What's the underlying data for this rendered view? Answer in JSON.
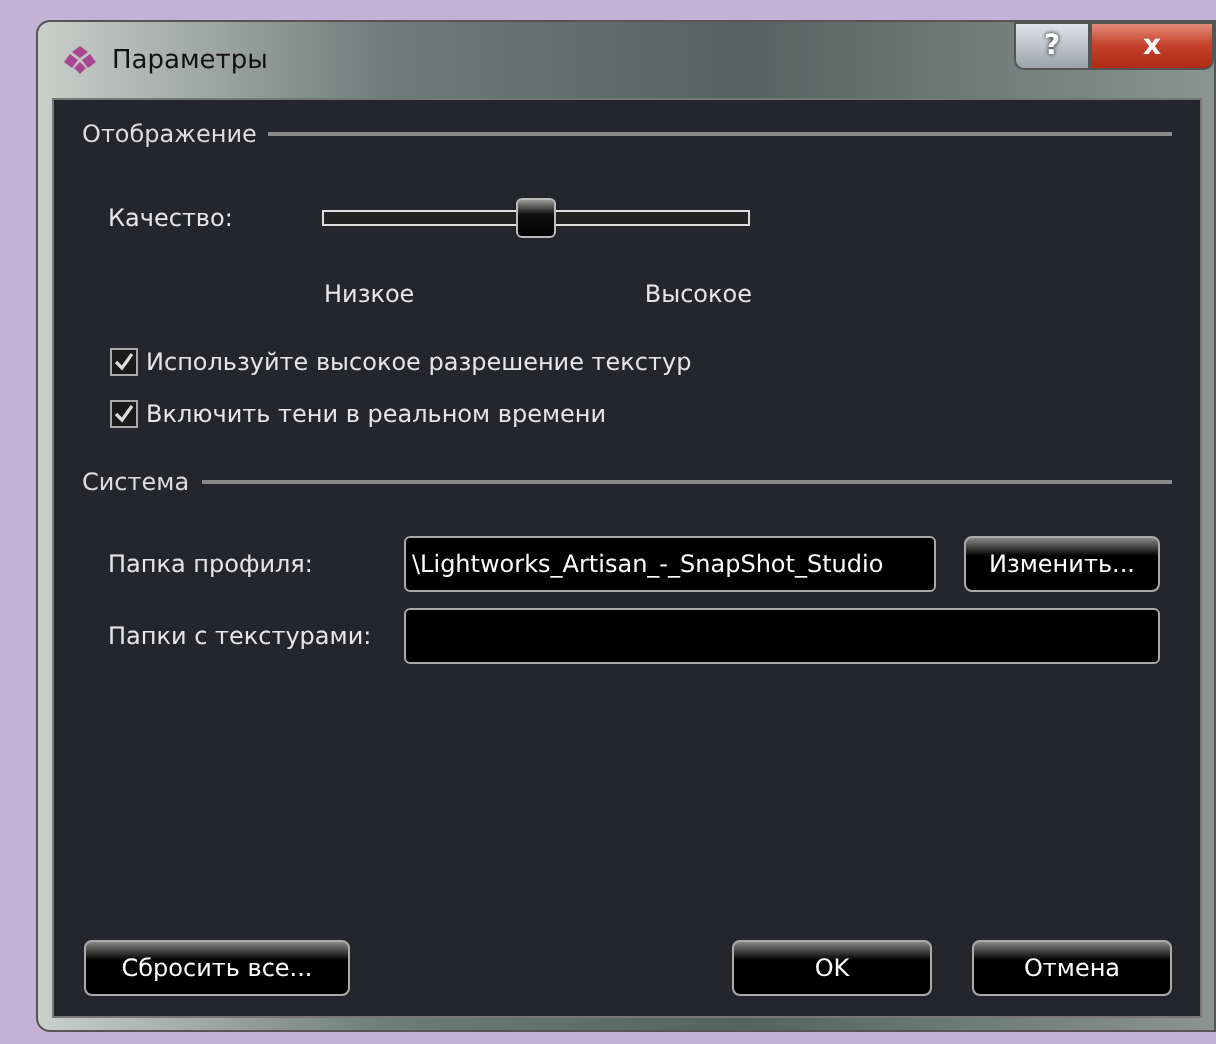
{
  "window": {
    "title": "Параметры",
    "buttons": [
      "?",
      "x"
    ]
  },
  "display": {
    "heading": "Отображение",
    "quality": {
      "label": "Качество:",
      "level": 0.5,
      "min_label": "Низкое",
      "max_label": "Высокое"
    },
    "options": [
      {
        "label": "Используйте высокое разрешение текстур",
        "checked": true
      },
      {
        "label": "Включить тени в реальном времени",
        "checked": true
      }
    ]
  },
  "system": {
    "heading": "Система",
    "fields": [
      {
        "label": "Папка профиля:",
        "value": "\\Lightworks_Artisan_-_SnapShot_Studio",
        "button": "Изменить..."
      },
      {
        "label": "Папки с текстурами:"
      }
    ]
  },
  "footer": {
    "reset": "Сбросить все...",
    "ok": "OK",
    "cancel": "Отмена"
  }
}
